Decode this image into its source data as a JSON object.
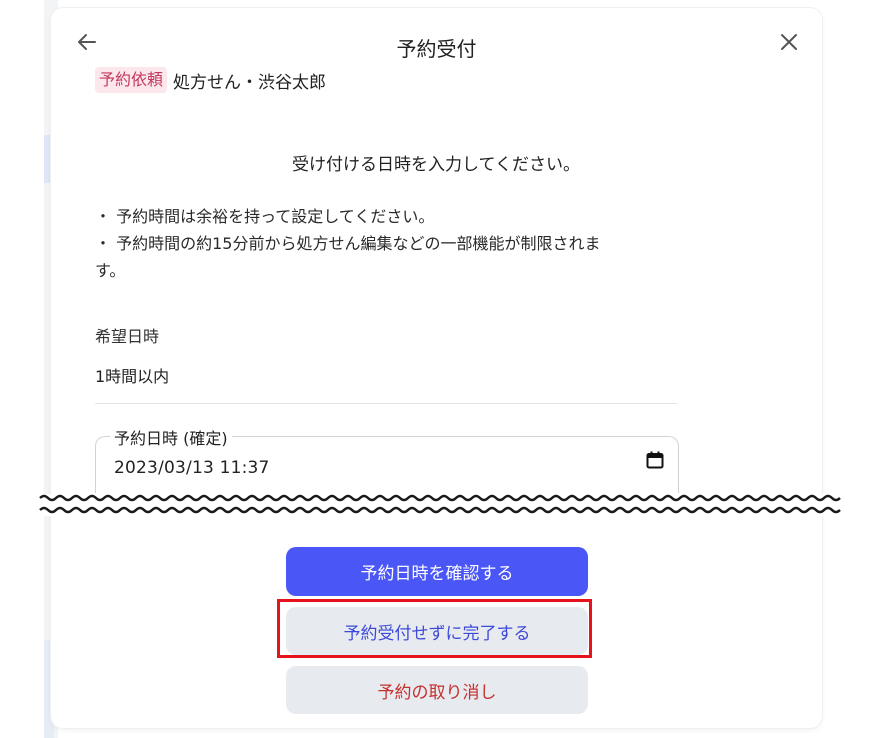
{
  "header": {
    "title": "予約受付"
  },
  "request": {
    "tag": "予約依頼",
    "summary": "処方せん・渋谷太郎"
  },
  "instruction": "受け付ける日時を入力してください。",
  "notes": [
    "・ 予約時間は余裕を持って設定してください。",
    "・ 予約時間の約15分前から処方せん編集などの一部機能が制限されま",
    "す。"
  ],
  "preferred": {
    "label": "希望日時",
    "value": "1時間以内"
  },
  "datetime_field": {
    "label": "予約日時 (確定)",
    "value": "2023/03/13  11:37"
  },
  "buttons": {
    "confirm": "予約日時を確認する",
    "complete_without_reservation": "予約受付せずに完了する",
    "cancel": "予約の取り消し"
  },
  "colors": {
    "primary": "#4a56f5",
    "tag_bg": "#fbe7ec",
    "tag_text": "#c33a5e",
    "cancel_text": "#c53030",
    "highlight": "#e5131b"
  },
  "icons": {
    "back": "arrow-left-icon",
    "close": "close-icon",
    "calendar": "calendar-icon"
  }
}
